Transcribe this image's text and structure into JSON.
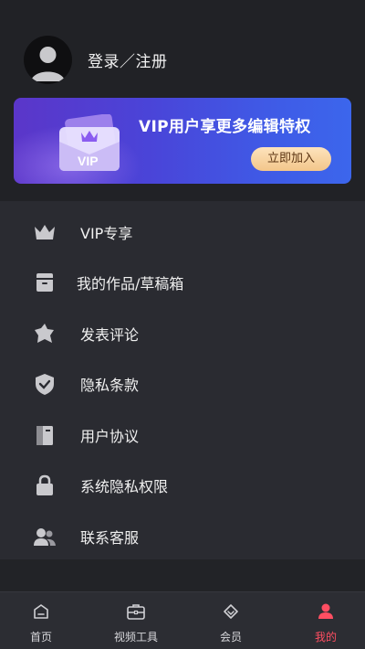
{
  "profile": {
    "login_label": "登录／注册"
  },
  "vip_banner": {
    "title": "VIP用户享更多编辑特权",
    "card_text": "VIP",
    "join_button": "立即加入"
  },
  "menu": {
    "items": [
      {
        "label": "VIP专享",
        "icon": "crown-icon"
      },
      {
        "label": "我的作品/草稿箱",
        "icon": "archive-box-icon"
      },
      {
        "label": "发表评论",
        "icon": "comment-badge-icon"
      },
      {
        "label": "隐私条款",
        "icon": "shield-check-icon"
      },
      {
        "label": "用户协议",
        "icon": "document-icon"
      },
      {
        "label": "系统隐私权限",
        "icon": "lock-icon"
      },
      {
        "label": "联系客服",
        "icon": "users-icon"
      }
    ]
  },
  "tabbar": {
    "tabs": [
      {
        "label": "首页",
        "icon": "home-icon",
        "active": false
      },
      {
        "label": "视频工具",
        "icon": "toolbox-icon",
        "active": false
      },
      {
        "label": "会员",
        "icon": "diamond-icon",
        "active": false
      },
      {
        "label": "我的",
        "icon": "person-icon",
        "active": true
      }
    ],
    "active_color": "#ff4e62"
  },
  "colors": {
    "background": "#2a2b31",
    "header_background": "#212226",
    "banner_gradient_start": "#5b36c9",
    "banner_gradient_end": "#3c66ec",
    "button_gold": "#f3c68a"
  }
}
